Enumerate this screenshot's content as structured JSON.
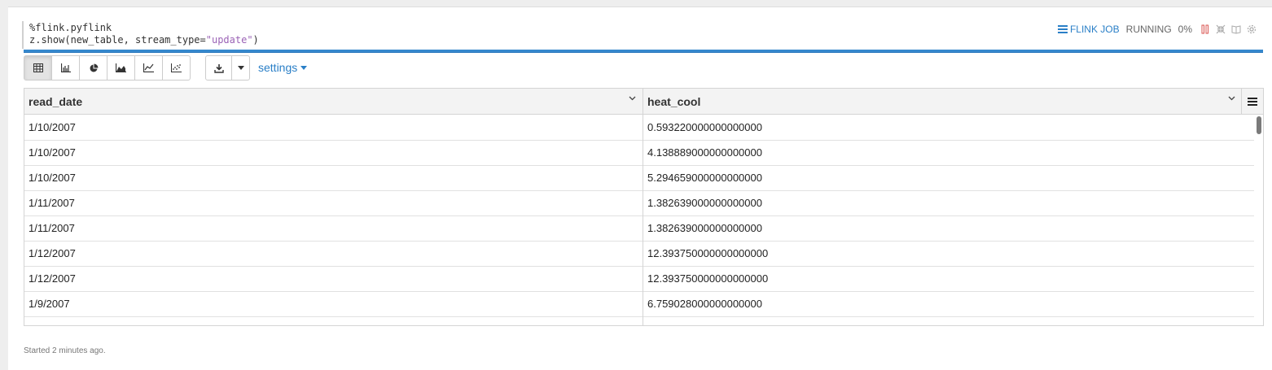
{
  "editor": {
    "line1": "%flink.pyflink",
    "line2_prefix": "z.show(new_table, stream_type=",
    "line2_string": "\"update\"",
    "line2_suffix": ")"
  },
  "header": {
    "job_label": "FLINK JOB",
    "status": "RUNNING",
    "progress": "0%"
  },
  "toolbar": {
    "buttons": [
      {
        "name": "table-icon",
        "active": true
      },
      {
        "name": "bar-chart-icon",
        "active": false
      },
      {
        "name": "pie-chart-icon",
        "active": false
      },
      {
        "name": "area-chart-icon",
        "active": false
      },
      {
        "name": "line-chart-icon",
        "active": false
      },
      {
        "name": "scatter-chart-icon",
        "active": false
      }
    ],
    "settings_label": "settings"
  },
  "table": {
    "columns": [
      "read_date",
      "heat_cool"
    ],
    "rows": [
      [
        "1/10/2007",
        "0.593220000000000000"
      ],
      [
        "1/10/2007",
        "4.138889000000000000"
      ],
      [
        "1/10/2007",
        "5.294659000000000000"
      ],
      [
        "1/11/2007",
        "1.382639000000000000"
      ],
      [
        "1/11/2007",
        "1.382639000000000000"
      ],
      [
        "1/12/2007",
        "12.393750000000000000"
      ],
      [
        "1/12/2007",
        "12.393750000000000000"
      ],
      [
        "1/9/2007",
        "6.759028000000000000"
      ]
    ]
  },
  "footer": {
    "status_text": "Started 2 minutes ago."
  },
  "colors": {
    "accent": "#2a7fc7",
    "run_stop": "#d9534f"
  }
}
